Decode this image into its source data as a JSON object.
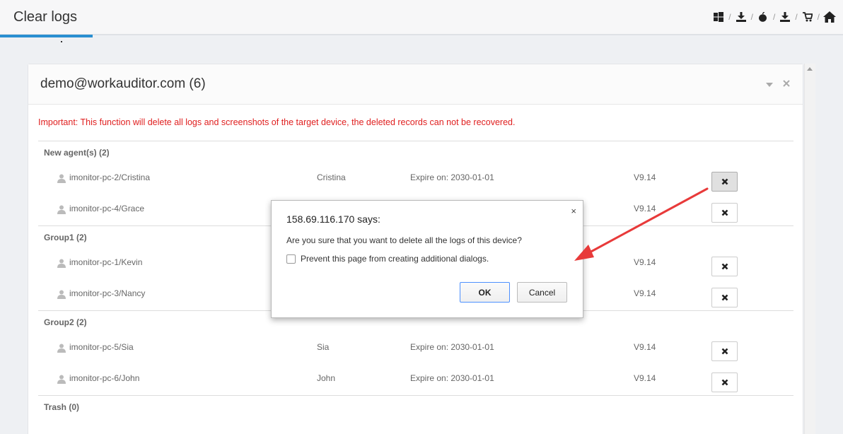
{
  "header": {
    "title": "Clear logs",
    "icons": [
      "windows-icon",
      "download-icon",
      "apple-icon",
      "download-icon",
      "cart-icon",
      "home-icon"
    ],
    "separator": "/"
  },
  "panel": {
    "title": "demo@workauditor.com (6)",
    "warning": "Important: This function will delete all logs and screenshots of the target device, the deleted records can not be recovered.",
    "groups": [
      {
        "label": "New agent(s) (2)",
        "rows": [
          {
            "name": "imonitor-pc-2/Cristina",
            "alias": "Cristina",
            "expire": "Expire on: 2030-01-01",
            "version": "V9.14"
          },
          {
            "name": "imonitor-pc-4/Grace",
            "alias": "",
            "expire": "",
            "version": "V9.14"
          }
        ]
      },
      {
        "label": "Group1 (2)",
        "rows": [
          {
            "name": "imonitor-pc-1/Kevin",
            "alias": "",
            "expire": "",
            "version": "V9.14"
          },
          {
            "name": "imonitor-pc-3/Nancy",
            "alias": "",
            "expire": "",
            "version": "V9.14"
          }
        ]
      },
      {
        "label": "Group2 (2)",
        "rows": [
          {
            "name": "imonitor-pc-5/Sia",
            "alias": "Sia",
            "expire": "Expire on: 2030-01-01",
            "version": "V9.14"
          },
          {
            "name": "imonitor-pc-6/John",
            "alias": "John",
            "expire": "Expire on: 2030-01-01",
            "version": "V9.14"
          }
        ]
      },
      {
        "label": "Trash (0)",
        "rows": []
      }
    ]
  },
  "dialog": {
    "title": "158.69.116.170 says:",
    "message": "Are you sure that you want to delete all the logs of this device?",
    "checkbox_label": "Prevent this page from creating additional dialogs.",
    "checkbox_checked": false,
    "ok_label": "OK",
    "cancel_label": "Cancel",
    "close_glyph": "×"
  },
  "colors": {
    "accent": "#2a8fd1",
    "warning": "#e02020",
    "annotation_arrow": "#e83a3a"
  }
}
